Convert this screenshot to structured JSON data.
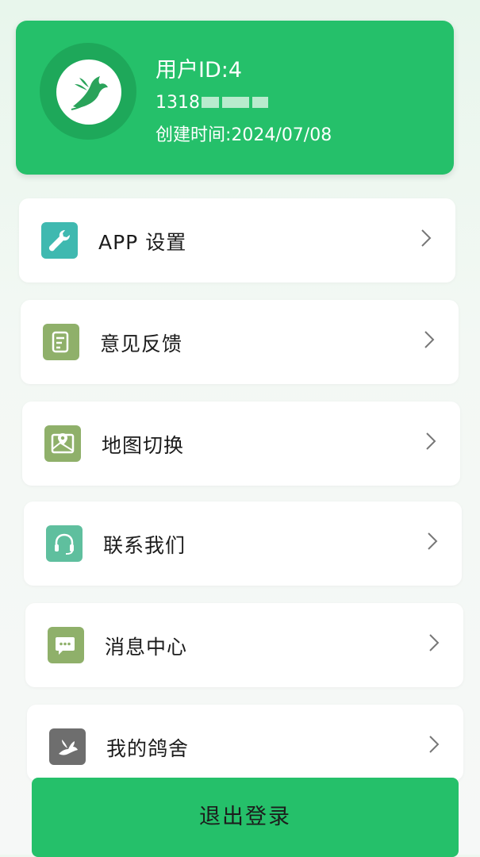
{
  "profile": {
    "user_id": "用户ID:4",
    "phone_visible": "1318",
    "created": "创建时间:2024/07/08",
    "avatar_icon": "bird-logo-icon"
  },
  "menu": [
    {
      "label": "APP 设置",
      "icon": "wrench-icon",
      "color": "#3fb9b0"
    },
    {
      "label": "意见反馈",
      "icon": "feedback-icon",
      "color": "#8fb06a"
    },
    {
      "label": "地图切换",
      "icon": "map-icon",
      "color": "#8fb06a"
    },
    {
      "label": "联系我们",
      "icon": "headset-icon",
      "color": "#5fbf9e"
    },
    {
      "label": "消息中心",
      "icon": "message-icon",
      "color": "#8fb06a"
    },
    {
      "label": "我的鸽舍",
      "icon": "pigeon-icon",
      "color": "#6e6e6e"
    }
  ],
  "logout": {
    "label": "退出登录"
  },
  "colors": {
    "brand_green": "#25c06a",
    "background": "#eef7f0"
  }
}
